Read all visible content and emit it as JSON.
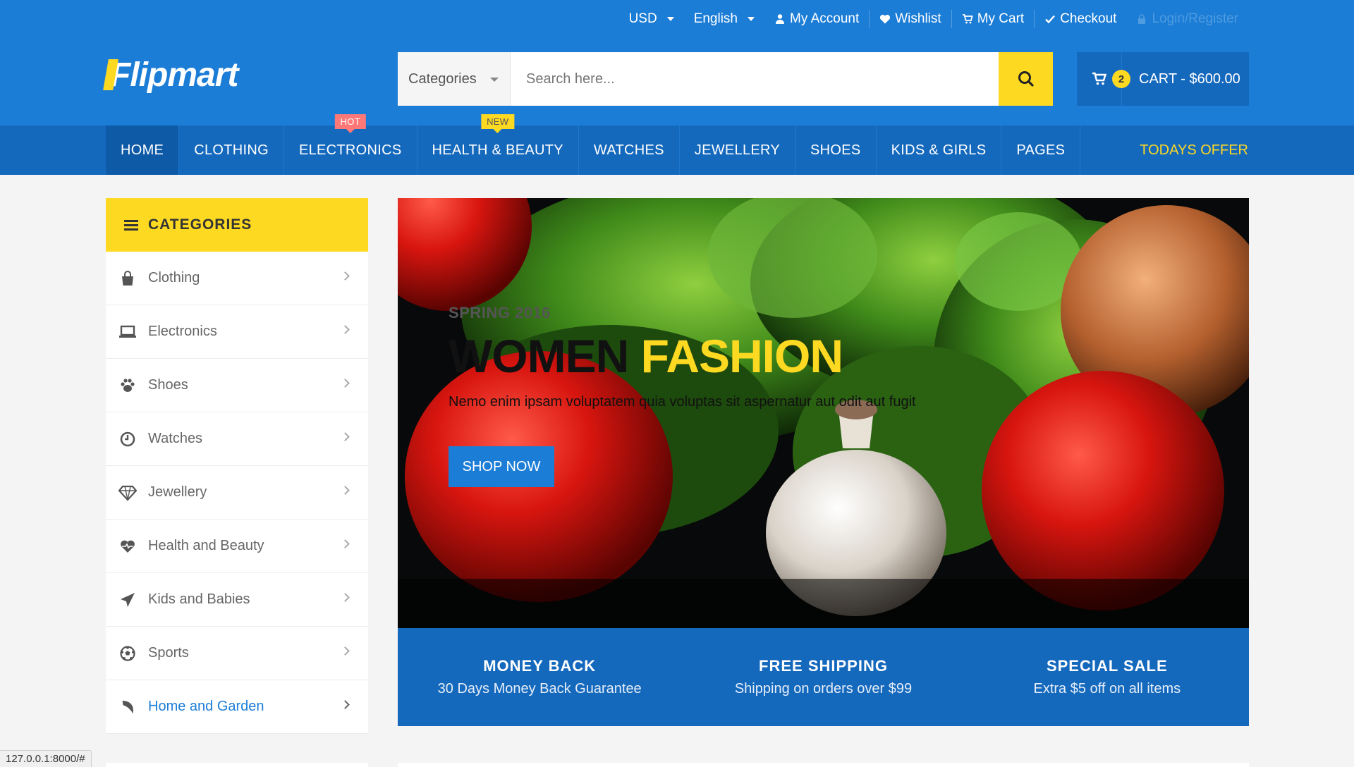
{
  "topbar": {
    "currency": "USD",
    "language": "English",
    "links": [
      {
        "label": "My Account",
        "icon": "user-icon"
      },
      {
        "label": "Wishlist",
        "icon": "heart-icon"
      },
      {
        "label": "My Cart",
        "icon": "cart-icon"
      },
      {
        "label": "Checkout",
        "icon": "check-icon"
      },
      {
        "label": "Login/Register",
        "icon": "lock-icon"
      }
    ]
  },
  "logo": {
    "text": "Flipmart"
  },
  "search": {
    "category_label": "Categories",
    "placeholder": "Search here..."
  },
  "cart": {
    "count": "2",
    "label": "CART - $600.00"
  },
  "nav": {
    "items": [
      {
        "label": "HOME"
      },
      {
        "label": "CLOTHING"
      },
      {
        "label": "ELECTRONICS",
        "tag": "HOT"
      },
      {
        "label": "HEALTH & BEAUTY",
        "tag": "NEW"
      },
      {
        "label": "WATCHES"
      },
      {
        "label": "JEWELLERY"
      },
      {
        "label": "SHOES"
      },
      {
        "label": "KIDS & GIRLS"
      },
      {
        "label": "PAGES"
      }
    ],
    "offer": "TODAYS OFFER"
  },
  "sidebar": {
    "heading": "CATEGORIES",
    "items": [
      {
        "label": "Clothing",
        "icon": "shopping-bag-icon"
      },
      {
        "label": "Electronics",
        "icon": "laptop-icon"
      },
      {
        "label": "Shoes",
        "icon": "paw-icon"
      },
      {
        "label": "Watches",
        "icon": "clock-icon"
      },
      {
        "label": "Jewellery",
        "icon": "diamond-icon"
      },
      {
        "label": "Health and Beauty",
        "icon": "heartbeat-icon"
      },
      {
        "label": "Kids and Babies",
        "icon": "paper-plane-icon"
      },
      {
        "label": "Sports",
        "icon": "futbol-icon"
      },
      {
        "label": "Home and Garden",
        "icon": "leaf-icon"
      }
    ]
  },
  "hero": {
    "subtitle": "SPRING 2016",
    "title_part1": "WOMEN",
    "title_part2": "FASHION",
    "description": "Nemo enim ipsam voluptatem quia voluptas sit aspernatur aut odit aut fugit",
    "button": "SHOP NOW"
  },
  "info": [
    {
      "title": "MONEY BACK",
      "text": "30 Days Money Back Guarantee"
    },
    {
      "title": "FREE SHIPPING",
      "text": "Shipping on orders over $99"
    },
    {
      "title": "SPECIAL SALE",
      "text": "Extra $5 off on all items"
    }
  ],
  "status_bar": {
    "url": "127.0.0.1:8000/#"
  },
  "colors": {
    "primary": "#1c7dd6",
    "dark": "#1569bd",
    "accent": "#fdd922",
    "hot": "#ff7878"
  }
}
